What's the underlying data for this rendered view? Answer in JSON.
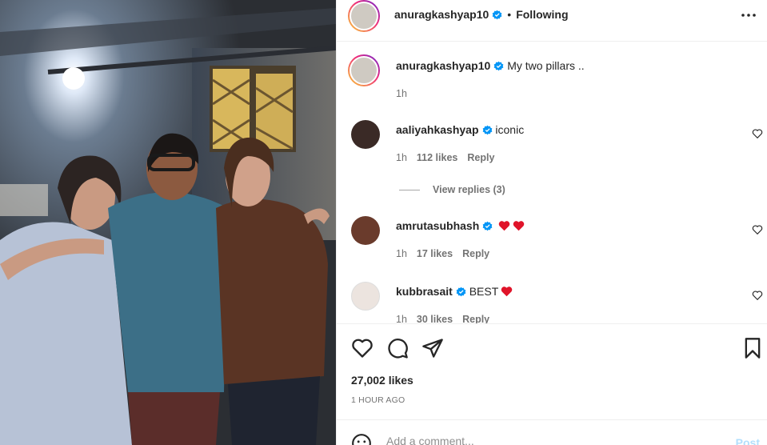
{
  "post": {
    "author": "anuragkashyap10",
    "dot": "•",
    "follow_status": "Following",
    "caption": "My two pillars ..",
    "caption_time": "1h",
    "likes": "27,002 likes",
    "time_ago": "1 HOUR AGO"
  },
  "comments": [
    {
      "user": "aaliyahkashyap",
      "text": "iconic",
      "time": "1h",
      "likes": "112 likes",
      "reply": "Reply",
      "view_replies": "View replies (3)"
    },
    {
      "user": "amrutasubhash",
      "text": "",
      "emoji": [
        "red-heart",
        "red-heart"
      ],
      "time": "1h",
      "likes": "17 likes",
      "reply": "Reply"
    },
    {
      "user": "kubbrasait",
      "text": "BEST",
      "emoji": [
        "red-heart"
      ],
      "time": "1h",
      "likes": "30 likes",
      "reply": "Reply"
    }
  ],
  "add_comment": {
    "placeholder": "Add a comment...",
    "post_label": "Post"
  },
  "icons": [
    "more-icon",
    "verified-badge-icon",
    "heart-icon",
    "comment-icon",
    "share-icon",
    "bookmark-icon",
    "emoji-smile-icon"
  ],
  "colors": {
    "verified": "#0095f6",
    "heart": "#ed4956",
    "post_disabled": "#b2dffc",
    "muted": "#737373"
  }
}
